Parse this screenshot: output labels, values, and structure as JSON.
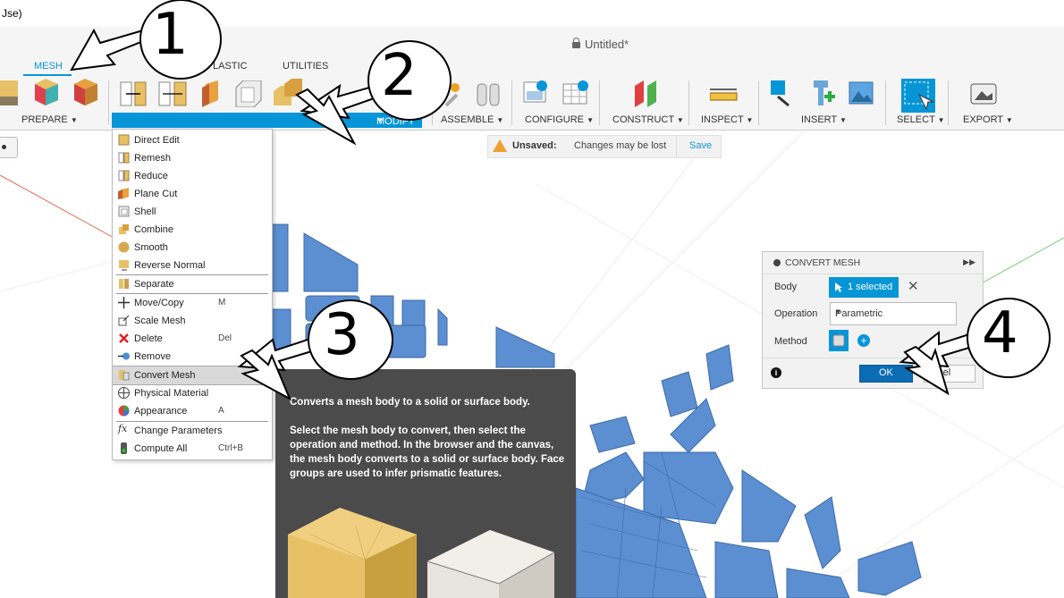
{
  "window": {
    "title_fragment": "Jse)"
  },
  "document": {
    "title": "Untitled*"
  },
  "tabs": [
    {
      "label": "MESH"
    },
    {
      "label": "LASTIC"
    },
    {
      "label": "UTILITIES"
    }
  ],
  "toolbar_groups": {
    "prepare": "PREPARE",
    "modify": "MODIFY",
    "assemble": "ASSEMBLE",
    "configure": "CONFIGURE",
    "construct": "CONSTRUCT",
    "inspect": "INSPECT",
    "insert": "INSERT",
    "select": "SELECT",
    "export": "EXPORT"
  },
  "unsaved_bar": {
    "label": "Unsaved:",
    "message": "Changes may be lost",
    "save": "Save"
  },
  "modify_menu": [
    {
      "label": "Direct Edit",
      "shortcut": ""
    },
    {
      "label": "Remesh",
      "shortcut": ""
    },
    {
      "label": "Reduce",
      "shortcut": ""
    },
    {
      "label": "Plane Cut",
      "shortcut": ""
    },
    {
      "label": "Shell",
      "shortcut": ""
    },
    {
      "label": "Combine",
      "shortcut": ""
    },
    {
      "label": "Smooth",
      "shortcut": ""
    },
    {
      "label": "Reverse Normal",
      "shortcut": ""
    },
    {
      "label": "Separate",
      "shortcut": ""
    },
    {
      "label": "Move/Copy",
      "shortcut": "M"
    },
    {
      "label": "Scale Mesh",
      "shortcut": ""
    },
    {
      "label": "Delete",
      "shortcut": "Del"
    },
    {
      "label": "Remove",
      "shortcut": ""
    },
    {
      "label": "Convert Mesh",
      "shortcut": ""
    },
    {
      "label": "Physical Material",
      "shortcut": ""
    },
    {
      "label": "Appearance",
      "shortcut": "A"
    },
    {
      "label": "Change Parameters",
      "shortcut": ""
    },
    {
      "label": "Compute All",
      "shortcut": "Ctrl+B"
    }
  ],
  "tooltip": {
    "summary": "Converts a mesh body to a solid or surface body.",
    "details": "Select the mesh body to convert, then select the operation and method. In the browser and the canvas, the mesh body converts to a solid or surface body. Face groups are used to infer prismatic features."
  },
  "convert_dialog": {
    "title": "CONVERT MESH",
    "body_label": "Body",
    "body_value": "1 selected",
    "operation_label": "Operation",
    "operation_value": "Parametric",
    "method_label": "Method",
    "ok": "OK",
    "cancel": "ncel"
  },
  "callouts": [
    "1",
    "2",
    "3",
    "4"
  ],
  "colors": {
    "accent": "#0696d7",
    "mesh": "#5b8fd1",
    "tooltip_bg": "#4b4b4b"
  }
}
